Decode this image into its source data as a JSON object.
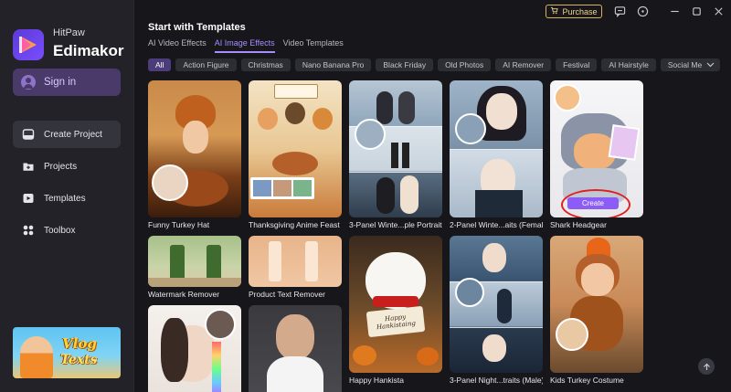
{
  "brand": {
    "top": "HitPaw",
    "main": "Edimakor"
  },
  "sidebar": {
    "signin_label": "Sign in",
    "items": [
      {
        "label": "Create Project",
        "icon": "create-project-icon"
      },
      {
        "label": "Projects",
        "icon": "folder-icon"
      },
      {
        "label": "Templates",
        "icon": "templates-icon"
      },
      {
        "label": "Toolbox",
        "icon": "toolbox-icon"
      }
    ],
    "promo": {
      "line1": "Vlog",
      "line2": "Texts"
    }
  },
  "titlebar": {
    "purchase_label": "Purchase"
  },
  "main": {
    "title": "Start with Templates",
    "tabs": [
      "AI Video Effects",
      "AI Image Effects",
      "Video Templates"
    ],
    "active_tab": "AI Image Effects",
    "chips": [
      "All",
      "Action Figure",
      "Christmas",
      "Nano Banana Pro",
      "Black Friday",
      "Old Photos",
      "AI Remover",
      "Festival",
      "AI Hairstyle",
      "Social Media"
    ],
    "active_chip": "All",
    "cards": [
      {
        "caption": "Funny Turkey Hat"
      },
      {
        "caption": "Thanksgiving Anime Feast"
      },
      {
        "caption": "3-Panel Winte...ple Portraits"
      },
      {
        "caption": "2-Panel Winte...aits (Female)"
      },
      {
        "caption": "Shark Headgear"
      },
      {
        "caption": "Watermark Remover"
      },
      {
        "caption": "Product Text Remover"
      },
      {
        "caption": "Happy Hankista"
      },
      {
        "caption": "3-Panel Night...traits (Male)"
      },
      {
        "caption": "Kids Turkey Costume"
      },
      {
        "caption": ""
      },
      {
        "caption": ""
      }
    ],
    "create_label": "Create",
    "sign_text_1": "Happy",
    "sign_text_2": "Hankistaing"
  },
  "colors": {
    "accent": "#a98bff",
    "button": "#8b5cf6",
    "highlight": "#e02020",
    "purchase": "#d9b25a"
  }
}
